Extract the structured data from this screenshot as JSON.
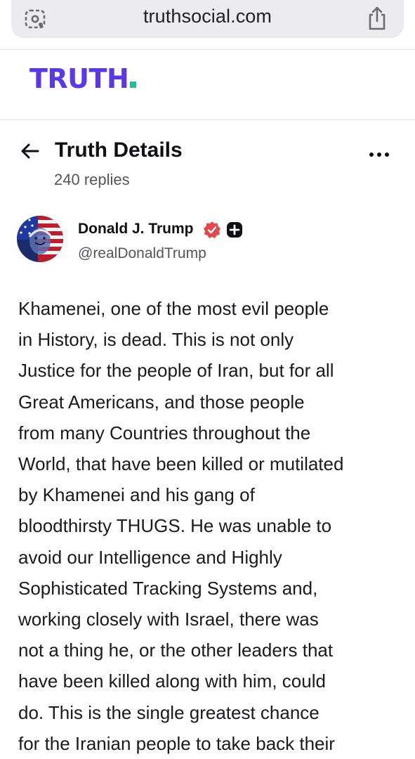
{
  "browser": {
    "url": "truthsocial.com",
    "left_icon": "site-settings-icon",
    "right_icon": "share-icon"
  },
  "header": {
    "logo_text": "TRUTH",
    "logo_color": "#5a38e8",
    "logo_dot_color": "#19c39a"
  },
  "details": {
    "title": "Truth Details",
    "replies": "240 replies",
    "back_icon": "back-arrow-icon",
    "more_icon": "more-options-icon"
  },
  "author": {
    "name": "Donald J. Trump",
    "handle": "@realDonaldTrump",
    "verified_color": "#e2484c",
    "badges": [
      "verified-icon",
      "plus-badge-icon"
    ]
  },
  "post": {
    "lines": [
      "Khamenei, one of the most evil people",
      "in History, is dead. This is not only",
      "Justice for the people of Iran, but for all",
      "Great Americans, and those people",
      "from many Countries throughout the",
      "World, that have been killed or mutilated",
      "by Khamenei and his gang of",
      "bloodthirsty THUGS. He was unable to",
      "avoid our Intelligence and Highly",
      "Sophisticated Tracking Systems and,",
      "working closely with Israel, there was",
      "not a thing he, or the other leaders that",
      "have been killed along with him, could",
      "do. This is the single greatest chance",
      "for the Iranian people to take back their"
    ]
  }
}
